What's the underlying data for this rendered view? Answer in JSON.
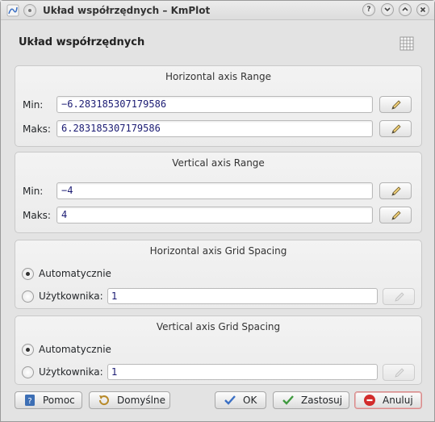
{
  "window": {
    "title": "Układ współrzędnych – KmPlot",
    "buttons": {
      "help": "?",
      "minimize": "v",
      "maximize": "^",
      "close": "x"
    }
  },
  "heading": "Układ współrzędnych",
  "horizontal_range": {
    "title": "Horizontal axis Range",
    "min_label": "Min:",
    "min_value": "−6.283185307179586",
    "max_label": "Maks:",
    "max_value": "6.283185307179586"
  },
  "vertical_range": {
    "title": "Vertical axis Range",
    "min_label": "Min:",
    "min_value": "−4",
    "max_label": "Maks:",
    "max_value": "4"
  },
  "horizontal_grid": {
    "title": "Horizontal axis Grid Spacing",
    "auto_label": "Automatycznie",
    "auto_checked": true,
    "user_label": "Użytkownika:",
    "user_value": "1"
  },
  "vertical_grid": {
    "title": "Vertical axis Grid Spacing",
    "auto_label": "Automatycznie",
    "auto_checked": true,
    "user_label": "Użytkownika:",
    "user_value": "1"
  },
  "footer": {
    "help": "Pomoc",
    "defaults": "Domyślne",
    "ok": "OK",
    "apply": "Zastosuj",
    "cancel": "Anuluj"
  },
  "icons": {
    "app": "kmplot-app-icon",
    "grid": "grid-icon",
    "edit": "edit-pencil-icon",
    "help": "help-book-icon",
    "defaults": "undo-arrow-icon",
    "ok": "checkmark-icon",
    "apply": "apply-checkmark-icon",
    "cancel": "cancel-icon"
  },
  "colors": {
    "input_text": "#1b1b73",
    "ok_check": "#3a6fc4",
    "apply_check": "#3f9a3f",
    "cancel": "#d22b2b"
  }
}
